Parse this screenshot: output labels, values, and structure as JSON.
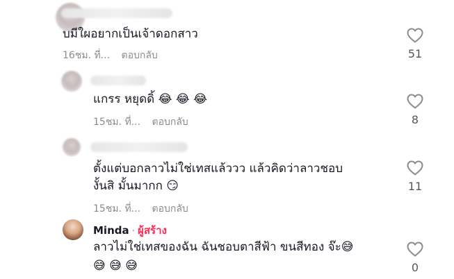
{
  "comments": [
    {
      "text_lines": [
        "บมีใผอยากเป็นเจ้าดอกสาว"
      ],
      "time": "16ชม. ที่...",
      "reply": "ตอบกลับ",
      "likes": "51"
    },
    {
      "text_lines": [
        "แกรร หยุดดิ้ 😂 😂 😂"
      ],
      "time": "15ชม. ที่...",
      "reply": "ตอบกลับ",
      "likes": "8"
    },
    {
      "text_lines": [
        "ตั้งแต่บอกลาวไม่ใช่เทสแล้ววว แล้วคิดว่าลาวชอบ",
        "งั้นสิ มั้นมากก 😏"
      ],
      "time": "15ชม. ที่...",
      "reply": "ตอบกลับ",
      "likes": "11"
    },
    {
      "author": "Minda",
      "separator": "·",
      "creator_badge": "ผู้สร้าง",
      "text_lines": [
        "ลาวไม่ใช่เทสของฉัน ฉันชอบตาสีฟ้า ขนสีทอง จ๊ะ😅",
        "😅 😅 😅"
      ],
      "likes": "0"
    }
  ],
  "icons": {
    "like": "heart-outline-icon"
  },
  "colors": {
    "creator": "#fe2c55",
    "meta": "#8a8b91",
    "text": "#161823"
  }
}
